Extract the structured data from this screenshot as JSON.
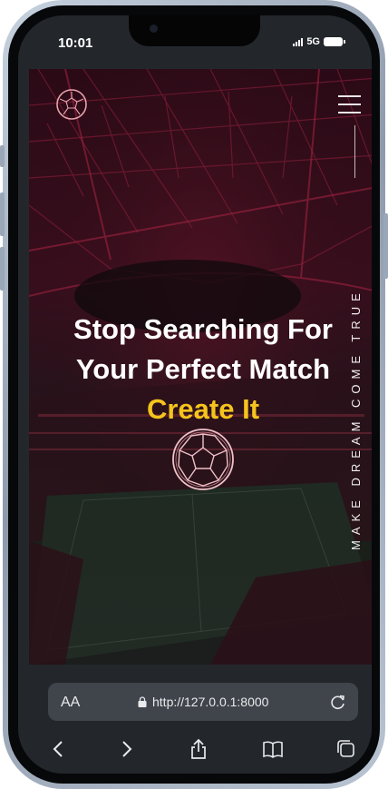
{
  "status_bar": {
    "time": "10:01",
    "network": "5G",
    "icons": [
      "signal-icon",
      "battery-icon"
    ]
  },
  "site": {
    "logo_icon": "soccer-ball-icon",
    "menu_icon": "hamburger-menu-icon",
    "vertical_tagline": "MAKE DREAM COME TRUE",
    "headline": {
      "line1": "Stop Searching For",
      "line2": "Your Perfect Match",
      "accent": "Create It"
    },
    "hero_icon": "soccer-ball-icon",
    "colors": {
      "accent": "#f5c41c",
      "overlay": "#3a0e1d"
    }
  },
  "browser": {
    "text_size_label": "AA",
    "url": "http://127.0.0.1:8000",
    "icons": [
      "lock-icon",
      "reload-icon",
      "back-icon",
      "forward-icon",
      "share-icon",
      "bookmarks-icon",
      "tabs-icon"
    ]
  }
}
